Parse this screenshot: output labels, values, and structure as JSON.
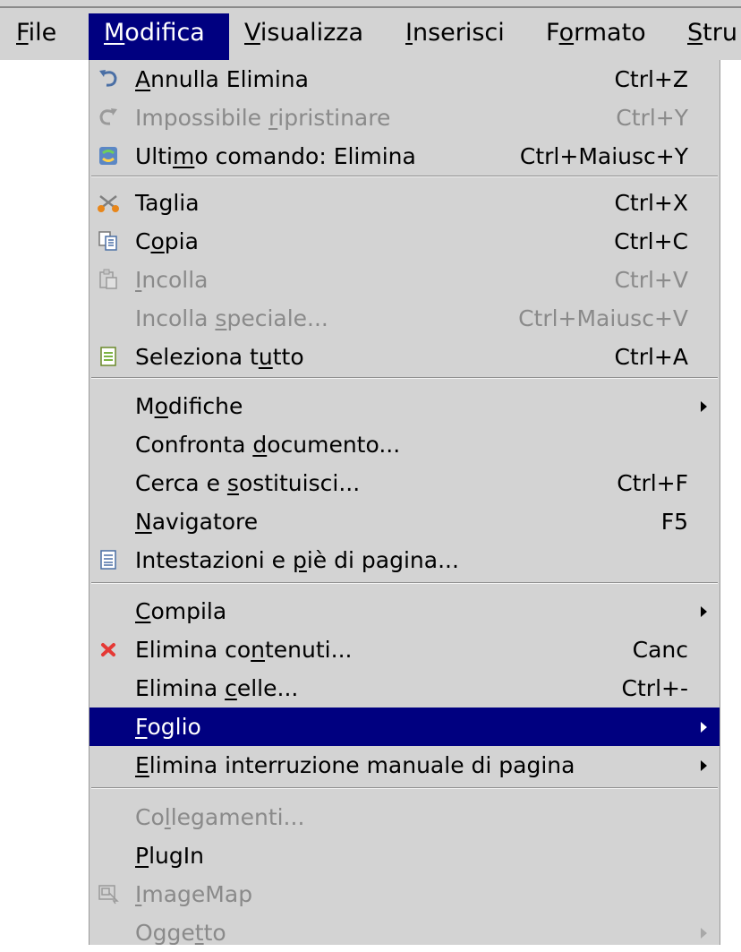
{
  "menubar": [
    {
      "pre": "",
      "u": "F",
      "post": "ile"
    },
    {
      "pre": "",
      "u": "M",
      "post": "odifica"
    },
    {
      "pre": "",
      "u": "V",
      "post": "isualizza"
    },
    {
      "pre": "",
      "u": "I",
      "post": "nserisci"
    },
    {
      "pre": "F",
      "u": "o",
      "post": "rmato"
    },
    {
      "pre": "",
      "u": "S",
      "post": "tru"
    }
  ],
  "menu": [
    {
      "pre": "",
      "u": "A",
      "post": "nnulla Elimina",
      "shortcut": "Ctrl+Z",
      "icon": "undo-icon"
    },
    {
      "pre": "Impossibile ",
      "u": "r",
      "post": "ipristinare",
      "shortcut": "Ctrl+Y",
      "icon": "redo-icon"
    },
    {
      "pre": "Ulti",
      "u": "m",
      "post": "o comando: Elimina",
      "shortcut": "Ctrl+Maiusc+Y",
      "icon": "repeat-icon"
    },
    {
      "pre": "Taglia",
      "u": "",
      "post": "",
      "shortcut": "Ctrl+X",
      "icon": "scissors-icon"
    },
    {
      "pre": "C",
      "u": "o",
      "post": "pia",
      "shortcut": "Ctrl+C",
      "icon": "copy-icon"
    },
    {
      "pre": "",
      "u": "I",
      "post": "ncolla",
      "shortcut": "Ctrl+V",
      "icon": "paste-icon"
    },
    {
      "pre": "Incolla ",
      "u": "s",
      "post": "peciale...",
      "shortcut": "Ctrl+Maiusc+V",
      "icon": ""
    },
    {
      "pre": "Seleziona t",
      "u": "u",
      "post": "tto",
      "shortcut": "Ctrl+A",
      "icon": "select-all-icon"
    },
    {
      "pre": "M",
      "u": "o",
      "post": "difiche",
      "shortcut": "",
      "icon": ""
    },
    {
      "pre": "Confronta ",
      "u": "d",
      "post": "ocumento...",
      "shortcut": "",
      "icon": ""
    },
    {
      "pre": "Cerca e ",
      "u": "s",
      "post": "ostituisci...",
      "shortcut": "Ctrl+F",
      "icon": ""
    },
    {
      "pre": "",
      "u": "N",
      "post": "avigatore",
      "shortcut": "F5",
      "icon": ""
    },
    {
      "pre": "Intestazioni e ",
      "u": "p",
      "post": "iè di pagina...",
      "shortcut": "",
      "icon": "header-footer-icon"
    },
    {
      "pre": "",
      "u": "C",
      "post": "ompila",
      "shortcut": "",
      "icon": ""
    },
    {
      "pre": "Elimina co",
      "u": "n",
      "post": "tenuti...",
      "shortcut": "Canc",
      "icon": "delete-x-icon"
    },
    {
      "pre": "Elimina ",
      "u": "c",
      "post": "elle...",
      "shortcut": "Ctrl+-",
      "icon": ""
    },
    {
      "pre": "",
      "u": "F",
      "post": "oglio",
      "shortcut": "",
      "icon": ""
    },
    {
      "pre": "",
      "u": "E",
      "post": "limina interruzione manuale di pagina",
      "shortcut": "",
      "icon": ""
    },
    {
      "pre": "Co",
      "u": "l",
      "post": "legamenti...",
      "shortcut": "",
      "icon": ""
    },
    {
      "pre": "",
      "u": "P",
      "post": "lugIn",
      "shortcut": "",
      "icon": ""
    },
    {
      "pre": "",
      "u": "I",
      "post": "mageMap",
      "shortcut": "",
      "icon": "imagemap-icon"
    },
    {
      "pre": "Ogge",
      "u": "t",
      "post": "to",
      "shortcut": "",
      "icon": ""
    }
  ]
}
